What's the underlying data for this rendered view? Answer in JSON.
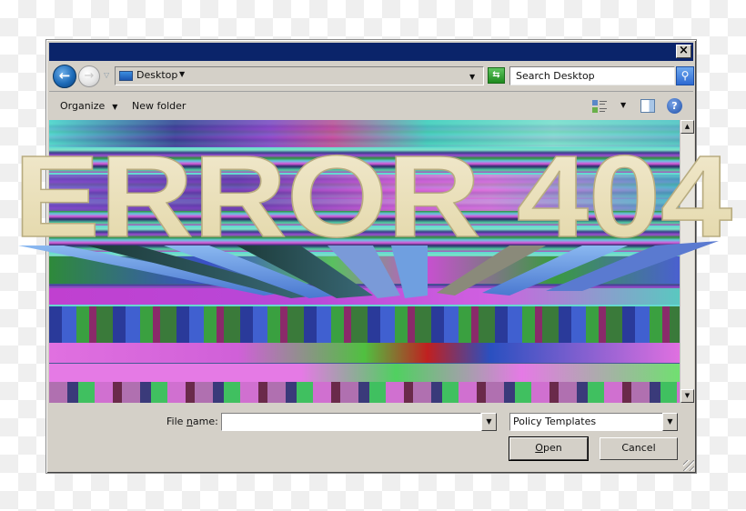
{
  "dialog": {
    "close_label": "×"
  },
  "address_bar": {
    "back_icon": "←",
    "forward_icon": "→",
    "history_caret": "▽",
    "location": "Desktop",
    "location_caret": "▼",
    "dropdown_caret": "▼",
    "refresh_icon": "⇆",
    "search_placeholder": "Search Desktop",
    "search_icon": "⚲"
  },
  "toolbar": {
    "organize_label": "Organize",
    "organize_caret": "▼",
    "new_folder_label": "New folder",
    "views_caret": "▼",
    "help_icon": "?"
  },
  "content": {
    "artwork_text": "ERROR 404",
    "scroll_up": "▲",
    "scroll_down": "▼"
  },
  "footer": {
    "file_name_label_pre": "File ",
    "file_name_label_accel": "n",
    "file_name_label_post": "ame:",
    "file_name_value": "",
    "file_name_drop": "▼",
    "file_type_value": "Policy Templates",
    "file_type_drop": "▼",
    "open_label_accel": "O",
    "open_label_rest": "pen",
    "cancel_label": "Cancel"
  },
  "colors": {
    "titlebar": "#0a246a",
    "dialog_face": "#d4d0c8",
    "art_face": "#efe6bf",
    "art_extrusion": "#6f9fe0"
  }
}
